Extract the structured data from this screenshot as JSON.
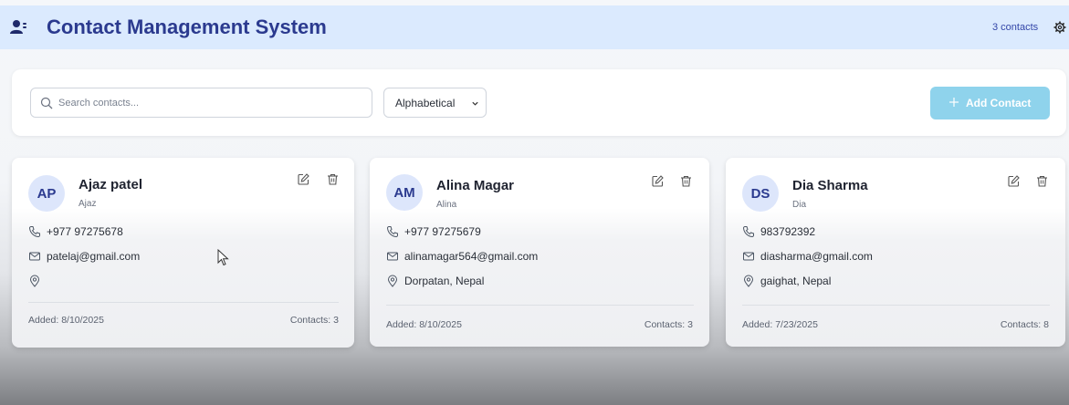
{
  "header": {
    "title": "Contact Management System",
    "contacts_count": "3 contacts",
    "app_icon": "users-icon",
    "settings_icon": "gear-icon"
  },
  "toolbar": {
    "search_placeholder": "Search contacts...",
    "sort_value": "Alphabetical",
    "add_label": "Add Contact"
  },
  "colors": {
    "header_bg": "#dbeafe",
    "title": "#2b3a8f",
    "add_button": "#8fd3ec",
    "avatar_bg": "#dde6fb"
  },
  "contacts": [
    {
      "initials": "AP",
      "name": "Ajaz patel",
      "nickname": "Ajaz",
      "phone": "+977 97275678",
      "email": "patelaj@gmail.com",
      "address": "",
      "added": "Added: 8/10/2025",
      "contacts": "Contacts: 3"
    },
    {
      "initials": "AM",
      "name": "Alina Magar",
      "nickname": "Alina",
      "phone": "+977 97275679",
      "email": "alinamagar564@gmail.com",
      "address": "Dorpatan, Nepal",
      "added": "Added: 8/10/2025",
      "contacts": "Contacts: 3"
    },
    {
      "initials": "DS",
      "name": "Dia Sharma",
      "nickname": "Dia",
      "phone": "983792392",
      "email": "diasharma@gmail.com",
      "address": "gaighat, Nepal",
      "added": "Added: 7/23/2025",
      "contacts": "Contacts: 8"
    }
  ]
}
